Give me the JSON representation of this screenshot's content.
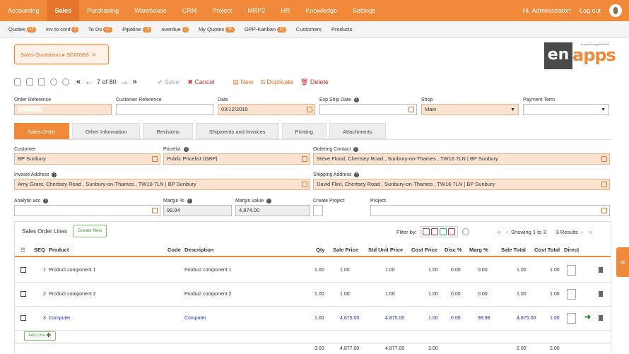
{
  "topnav": {
    "items": [
      "Accounting",
      "Sales",
      "Purchasing",
      "Warehouse",
      "CRM",
      "Project",
      "MRP2",
      "HR",
      "Knowledge",
      "Settings"
    ],
    "active": "Sales",
    "greeting": "Hi, Administrator!",
    "logout": "Log out"
  },
  "subnav": [
    {
      "label": "Quotes",
      "badge": "35"
    },
    {
      "label": "Inv to conf",
      "badge": "3"
    },
    {
      "label": "To Do",
      "badge": "47"
    },
    {
      "label": "Pipeline",
      "badge": "15"
    },
    {
      "label": "overdue",
      "badge": "2"
    },
    {
      "label": "My Quotes",
      "badge": "35"
    },
    {
      "label": "OPP-Kanban",
      "badge": "15"
    },
    {
      "label": "Customers",
      "badge": ""
    },
    {
      "label": "Products",
      "badge": ""
    }
  ],
  "breadcrumb": "Sales Quotations ▸ SO00593",
  "breadcrumb_close": "✕",
  "logo": {
    "box": "en",
    "apps": "apps",
    "tag": "enterprise applications"
  },
  "toolbar": {
    "record_pos": "7 of 80",
    "save": "✔ Save",
    "cancel": "✖ Cancel",
    "new": "New",
    "duplicate": "Duplicate",
    "delete": "Delete"
  },
  "header_fields": {
    "order_ref": {
      "label": "Order Reference",
      "value": "SO00593"
    },
    "customer_ref": {
      "label": "Customer Reference",
      "value": ""
    },
    "date": {
      "label": "Date",
      "value": "03/12/2019"
    },
    "exp_ship": {
      "label": "Exp Ship Date",
      "value": ""
    },
    "shop": {
      "label": "Shop",
      "value": "Main"
    },
    "payment_term": {
      "label": "Payment Term",
      "value": ""
    }
  },
  "tabs": [
    "Sales Order",
    "Other Information",
    "Revisions",
    "Shipments and Invoices",
    "Printing",
    "Attachments"
  ],
  "form": {
    "customer": {
      "label": "Customer",
      "value": "BP Sunbury"
    },
    "pricelist": {
      "label": "Pricelist",
      "value": "Public Pricelist (GBP)"
    },
    "ordering_contact": {
      "label": "Ordering Contact",
      "value": "Steve Flood, Chertsey Road , Sunbury-on-Thames , TW16 7LN | BP Sunbury"
    },
    "invoice_address": {
      "label": "Invoice Address",
      "value": "Amy Grant, Chertsey Road , Sunbury-on-Thames , TW16 7LN | BP Sunbury"
    },
    "shipping_address": {
      "label": "Shipping Address",
      "value": "David Flint, Chertsey Road , Sunbury-on-Thames , TW16 7LN | BP Sunbury"
    },
    "analytic_acc": {
      "label": "Analytic acc",
      "value": ""
    },
    "margin_pct": {
      "label": "Margin %",
      "value": "99.94"
    },
    "margin_value": {
      "label": "Margin value",
      "value": "4,874.00"
    },
    "create_project": {
      "label": "Create Project"
    },
    "project": {
      "label": "Project",
      "value": ""
    }
  },
  "lines": {
    "title": "Sales Order Lines",
    "create_new": "Create New",
    "filter_label": "Filter by:",
    "paging": "Showing 1 to 3",
    "results": "3 Results",
    "columns": [
      "SEQ",
      "Product",
      "Code",
      "Description",
      "Qty",
      "Sale Price",
      "Std Unit Price",
      "Cost Price",
      "Disc %",
      "Marg %",
      "Sale Total",
      "Cost Total",
      "Direct"
    ],
    "rows": [
      {
        "seq": "1",
        "product": "Product component 1",
        "code": "",
        "desc": "Product component 1",
        "qty": "1.00",
        "sale": "1.00",
        "std": "1.00",
        "cost": "1.00",
        "disc": "0.00",
        "marg": "0.00",
        "stotal": "1.00",
        "ctotal": "1.00"
      },
      {
        "seq": "2",
        "product": "Product component 2",
        "code": "",
        "desc": "Product component 2",
        "qty": "1.00",
        "sale": "1.00",
        "std": "1.00",
        "cost": "1.00",
        "disc": "0.00",
        "marg": "0.00",
        "stotal": "1.00",
        "ctotal": "1.00"
      },
      {
        "seq": "3",
        "product": "Computer",
        "code": "",
        "desc": "Computer",
        "qty": "1.00",
        "sale": "4,875.00",
        "std": "4,875.00",
        "cost": "1.00",
        "disc": "0.00",
        "marg": "99.98",
        "stotal": "4,875.00",
        "ctotal": "1.00"
      }
    ],
    "add_line": "Add Line ➕",
    "totals": {
      "qty": "3.00",
      "sale": "4,877.00",
      "std": "4,877.00",
      "cost": "3.00",
      "stotal": "2.00",
      "ctotal": "2.00"
    }
  },
  "side_toggle": "«"
}
